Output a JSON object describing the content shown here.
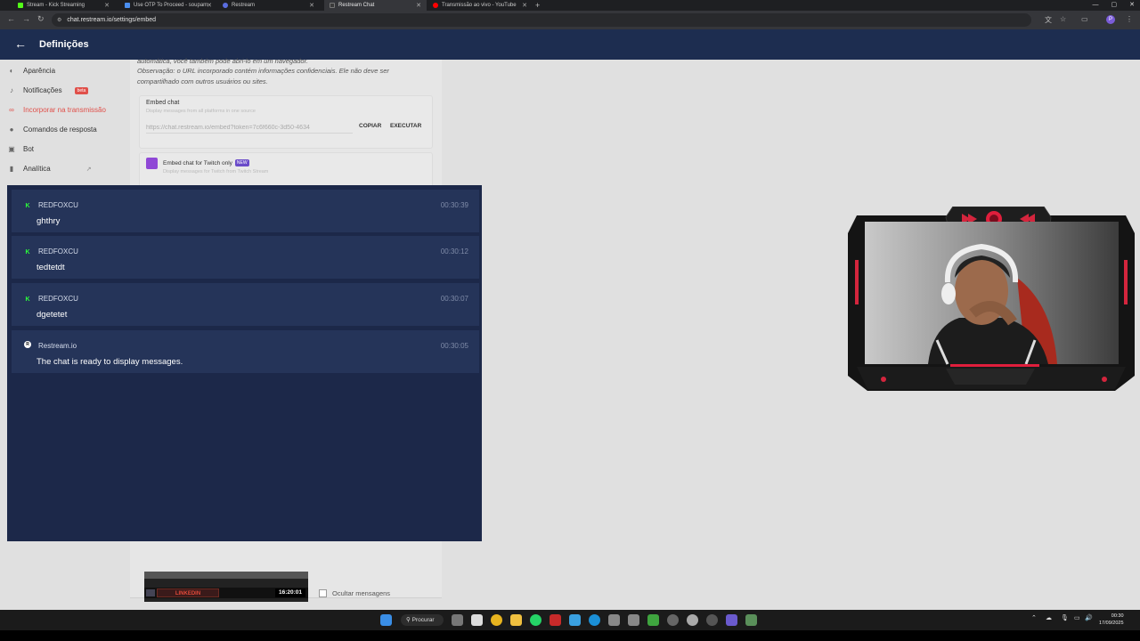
{
  "browser": {
    "tabs": [
      {
        "label": "Stream - Kick Streaming",
        "icon": "kick-icon",
        "color": "#53fc18",
        "active": false
      },
      {
        "label": "Use OTP To Proceed - soupam",
        "icon": "otp-icon",
        "color": "#4a8ef0",
        "active": false
      },
      {
        "label": "Restream",
        "icon": "restream-icon",
        "color": "#5a6de0",
        "active": false
      },
      {
        "label": "Restream Chat",
        "icon": "restream-chat-icon",
        "color": "#3a3a3a",
        "active": true
      },
      {
        "label": "Transmissão ao vivo - YouTube",
        "icon": "youtube-icon",
        "color": "#ff0000",
        "active": false
      }
    ],
    "url": "chat.restream.io/settings/embed"
  },
  "app": {
    "title": "Definições"
  },
  "sidebar": {
    "items": [
      {
        "label": "Aparência",
        "icon": "appearance-icon",
        "glyph": "◐"
      },
      {
        "label": "Notificações",
        "icon": "bell-icon",
        "glyph": "🔔",
        "badge": "beta"
      },
      {
        "label": "Incorporar na transmissão",
        "icon": "link-icon",
        "glyph": "⊂⊃",
        "active": true
      },
      {
        "label": "Comandos de resposta",
        "icon": "comment-icon",
        "glyph": "●"
      },
      {
        "label": "Bot",
        "icon": "bot-icon",
        "glyph": "▣"
      },
      {
        "label": "Analítica",
        "icon": "bar-chart-icon",
        "glyph": "▮",
        "external": "↗"
      }
    ]
  },
  "settings": {
    "note_top": "automática, você também pode abri-lo em um navegador.",
    "note": "Observação: o URL incorporado contém informações confidenciais. Ele não deve ser compartilhado com outros usuários ou sites.",
    "embed": {
      "title": "Embed chat",
      "subtitle": "Display messages from all platforms in one source",
      "url": "https://chat.restream.io/embed?token=7c6f660c-3d50-4634",
      "copy_label": "COPIAR",
      "execute_label": "EXECUTAR"
    },
    "twitch_embed": {
      "title": "Embed chat for Twitch only",
      "badge": "NEW",
      "subtitle": "Display messages for Twitch from Twitch Stream"
    },
    "preview": {
      "label": "LINKEDIN",
      "time": "16:20:01"
    },
    "hide_messages_label": "Ocultar mensagens"
  },
  "chat": {
    "messages": [
      {
        "author": "REDFOXCU",
        "platform": "kick",
        "time": "00:30:39",
        "text": "ghthry"
      },
      {
        "author": "REDFOXCU",
        "platform": "kick",
        "time": "00:30:12",
        "text": "tedtetdt"
      },
      {
        "author": "REDFOXCU",
        "platform": "kick",
        "time": "00:30:07",
        "text": "dgetetet"
      },
      {
        "author": "Restream.io",
        "platform": "restream",
        "time": "00:30:05",
        "text": "The chat is ready to display messages."
      }
    ]
  },
  "taskbar": {
    "search_label": "Procurar",
    "clock_time": "00:30",
    "clock_date": "17/09/2025"
  }
}
